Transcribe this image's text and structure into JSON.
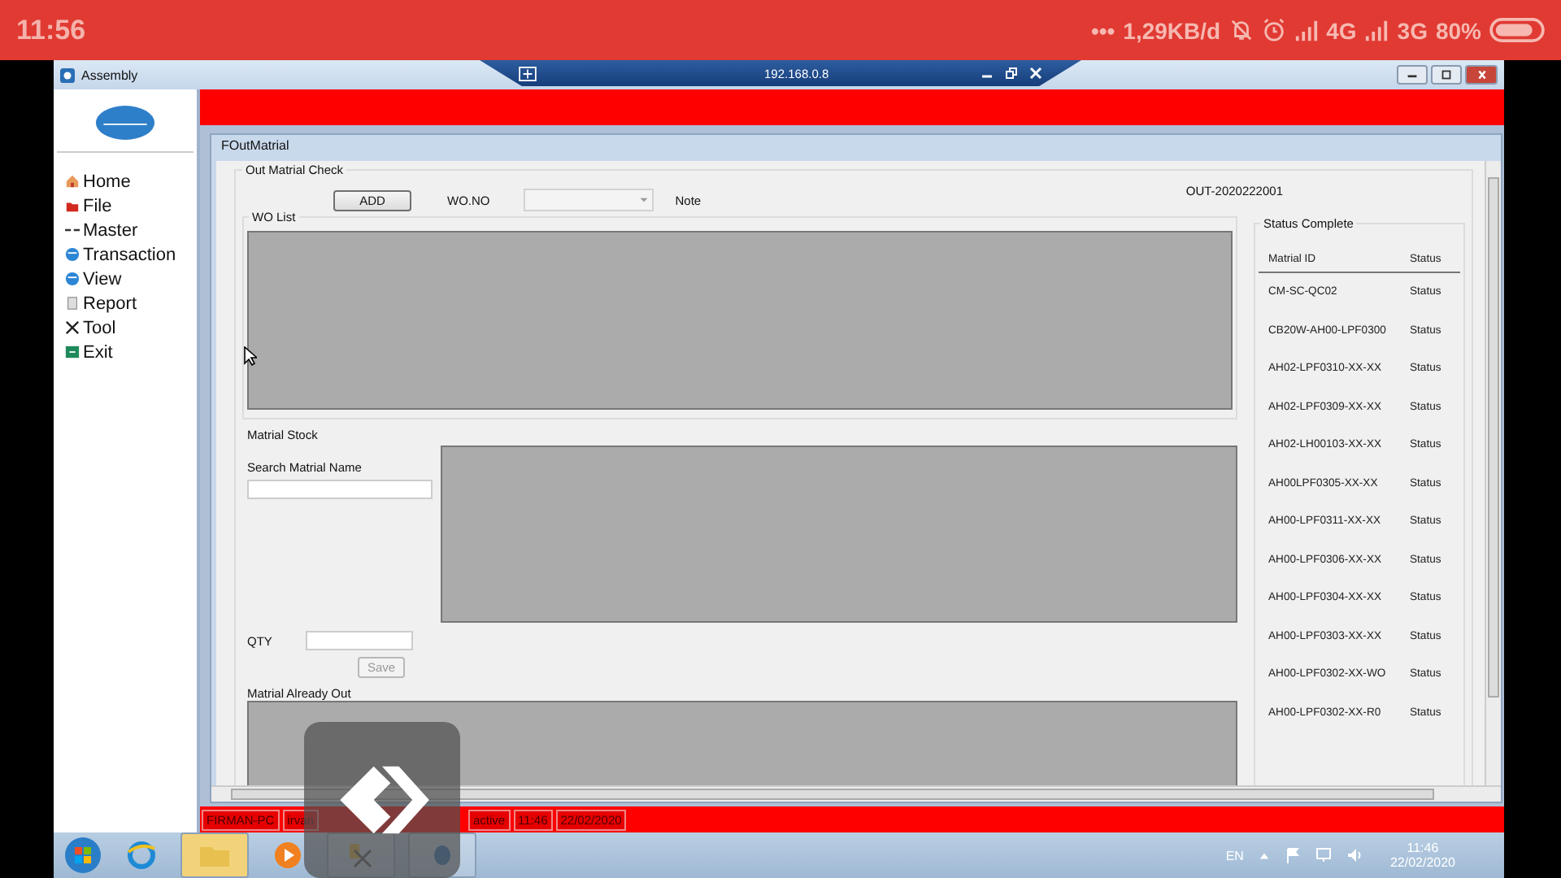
{
  "phone_status_bar": {
    "time": "11:56",
    "dots": "•••",
    "speed": "1,29KB/d",
    "network_1": "4G",
    "network_2": "3G",
    "battery": "80%"
  },
  "remote_bar": {
    "address": "192.168.0.8"
  },
  "window": {
    "title": "Assembly"
  },
  "sidebar": {
    "items": [
      {
        "label": "Home"
      },
      {
        "label": "File"
      },
      {
        "label": "Master"
      },
      {
        "label": "Transaction"
      },
      {
        "label": "View"
      },
      {
        "label": "Report"
      },
      {
        "label": "Tool"
      },
      {
        "label": "Exit"
      }
    ]
  },
  "child_window": {
    "title": "FOutMatrial"
  },
  "out_check": {
    "group": "Out Matrial Check",
    "add_button": "ADD",
    "wo_label": "WO.NO",
    "wo_field": {
      "disabled": true
    },
    "note_label": "Note",
    "number": "OUT-2020222001"
  },
  "wo_list": {
    "label": "WO List"
  },
  "stock": {
    "label": "Matrial Stock",
    "search_label": "Search Matrial Name",
    "qty_label": "QTY",
    "save_button": {
      "label": "Save",
      "disabled": true
    }
  },
  "already_out": {
    "label": "Matrial Already Out"
  },
  "status_complete": {
    "label": "Status Complete",
    "columns": [
      "Matrial ID",
      "Status"
    ],
    "rows": [
      {
        "id": "CM-SC-QC02",
        "status": "Status"
      },
      {
        "id": "CB20W-AH00-LPF0300",
        "status": "Status"
      },
      {
        "id": "AH02-LPF0310-XX-XX",
        "status": "Status"
      },
      {
        "id": "AH02-LPF0309-XX-XX",
        "status": "Status"
      },
      {
        "id": "AH02-LH00103-XX-XX",
        "status": "Status"
      },
      {
        "id": "AH00LPF0305-XX-XX",
        "status": "Status"
      },
      {
        "id": "AH00-LPF0311-XX-XX",
        "status": "Status"
      },
      {
        "id": "AH00-LPF0306-XX-XX",
        "status": "Status"
      },
      {
        "id": "AH00-LPF0304-XX-XX",
        "status": "Status"
      },
      {
        "id": "AH00-LPF0303-XX-XX",
        "status": "Status"
      },
      {
        "id": "AH00-LPF0302-XX-WO",
        "status": "Status"
      },
      {
        "id": "AH00-LPF0302-XX-R0",
        "status": "Status"
      }
    ]
  },
  "status_bar": [
    "FIRMAN-PC",
    "irvan",
    "active",
    "11:46",
    "22/02/2020"
  ],
  "taskbar": {
    "language": "EN",
    "time": "11:46",
    "date": "22/02/2020"
  }
}
